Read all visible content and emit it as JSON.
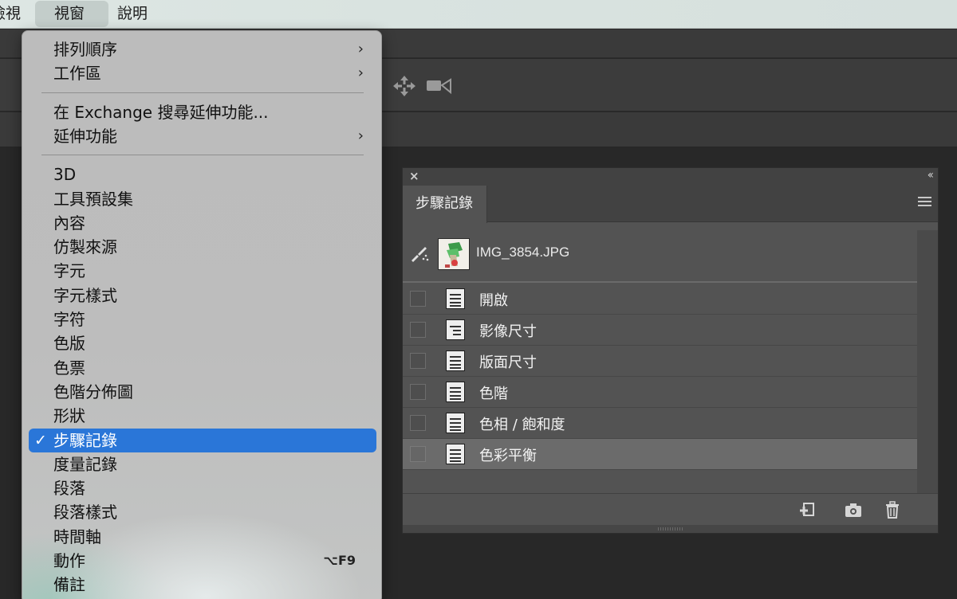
{
  "menubar": {
    "items": [
      {
        "label": "檢視"
      },
      {
        "label": "視窗"
      },
      {
        "label": "說明"
      }
    ],
    "active_index": 1
  },
  "window_menu": {
    "items": [
      {
        "label": "排列順序",
        "submenu": true
      },
      {
        "label": "工作區",
        "submenu": true
      },
      {
        "separator": true
      },
      {
        "label": "在 Exchange 搜尋延伸功能..."
      },
      {
        "label": "延伸功能",
        "submenu": true
      },
      {
        "separator": true
      },
      {
        "label": "3D"
      },
      {
        "label": "工具預設集"
      },
      {
        "label": "內容"
      },
      {
        "label": "仿製來源"
      },
      {
        "label": "字元"
      },
      {
        "label": "字元樣式"
      },
      {
        "label": "字符"
      },
      {
        "label": "色版"
      },
      {
        "label": "色票"
      },
      {
        "label": "色階分佈圖"
      },
      {
        "label": "形狀"
      },
      {
        "label": "步驟記錄",
        "checked": true,
        "highlighted": true
      },
      {
        "label": "度量記錄"
      },
      {
        "label": "段落"
      },
      {
        "label": "段落樣式"
      },
      {
        "label": "時間軸"
      },
      {
        "label": "動作",
        "shortcut": "⌥F9"
      },
      {
        "label": "備註"
      }
    ],
    "submenu_glyph": "›",
    "check_glyph": "✓"
  },
  "history_panel": {
    "close_glyph": "×",
    "collapse_glyph": "‹‹",
    "tab_label": "步驟記錄",
    "snapshot_name": "IMG_3854.JPG",
    "states": [
      {
        "label": "開啟",
        "icon": "document-icon",
        "selected": false
      },
      {
        "label": "影像尺寸",
        "icon": "dialog-document-icon",
        "selected": false
      },
      {
        "label": "版面尺寸",
        "icon": "document-icon",
        "selected": false
      },
      {
        "label": "色階",
        "icon": "document-icon",
        "selected": false
      },
      {
        "label": "色相 / 飽和度",
        "icon": "document-icon",
        "selected": false
      },
      {
        "label": "色彩平衡",
        "icon": "document-icon",
        "selected": true
      }
    ],
    "footer_icons": [
      "new-document-from-state-icon",
      "camera-icon",
      "trash-icon"
    ]
  },
  "colors": {
    "menu_highlight": "#2a76d8",
    "panel_bg": "#535353",
    "workspace_bg": "#282828"
  }
}
